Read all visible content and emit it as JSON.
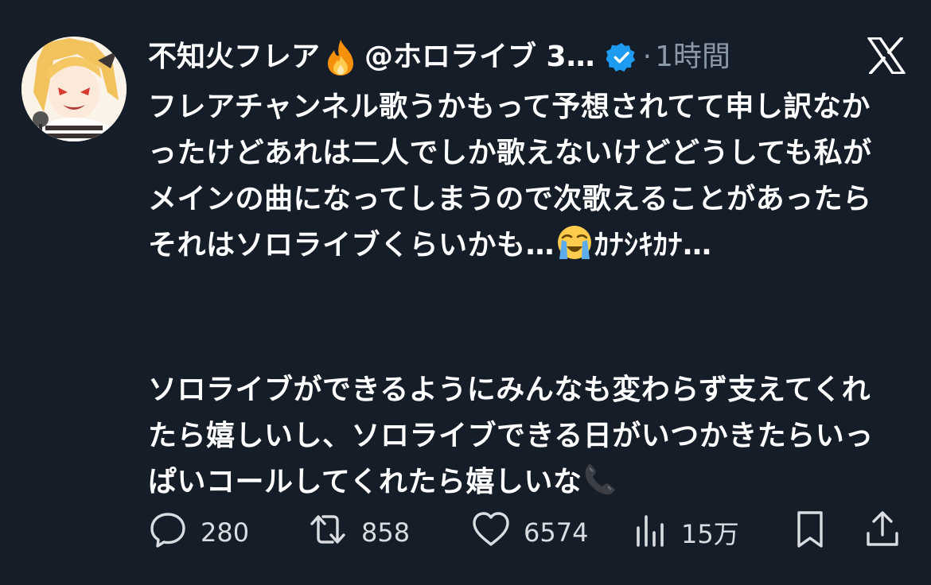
{
  "author": {
    "display_name": "不知火フレア",
    "handle_truncated": "@ホロライブ 3…",
    "separator": "·",
    "time": "1時間",
    "verified": true,
    "name_emoji": "fire-emoji"
  },
  "brand_icon": "x-logo-icon",
  "post": {
    "paragraph1": "フレアチャンネル歌うかもって予想されてて申し訳なかったけどあれは二人でしか歌えないけどどうしても私がメインの曲になってしまうので次歌えることがあったらそれはソロライブくらいかも…",
    "paragraph1_emoji": "loudly-crying-face-emoji",
    "paragraph1_tail": "ｶﾅｼｷｶﾅ…",
    "paragraph2": "ソロライブができるようにみんなも変わらず支えてくれたら嬉しいし、ソロライブできる日がいつかきたらいっぱいコールしてくれたら嬉しいな",
    "paragraph2_emoji": "telephone-receiver-emoji"
  },
  "actions": {
    "replies": "280",
    "reposts": "858",
    "likes": "6574",
    "views": "15万"
  },
  "colors": {
    "background": "#151d28",
    "text": "#ffffff",
    "muted": "#8b98a5",
    "verified": "#1d9bf0",
    "action_icon": "#d9dde2"
  }
}
